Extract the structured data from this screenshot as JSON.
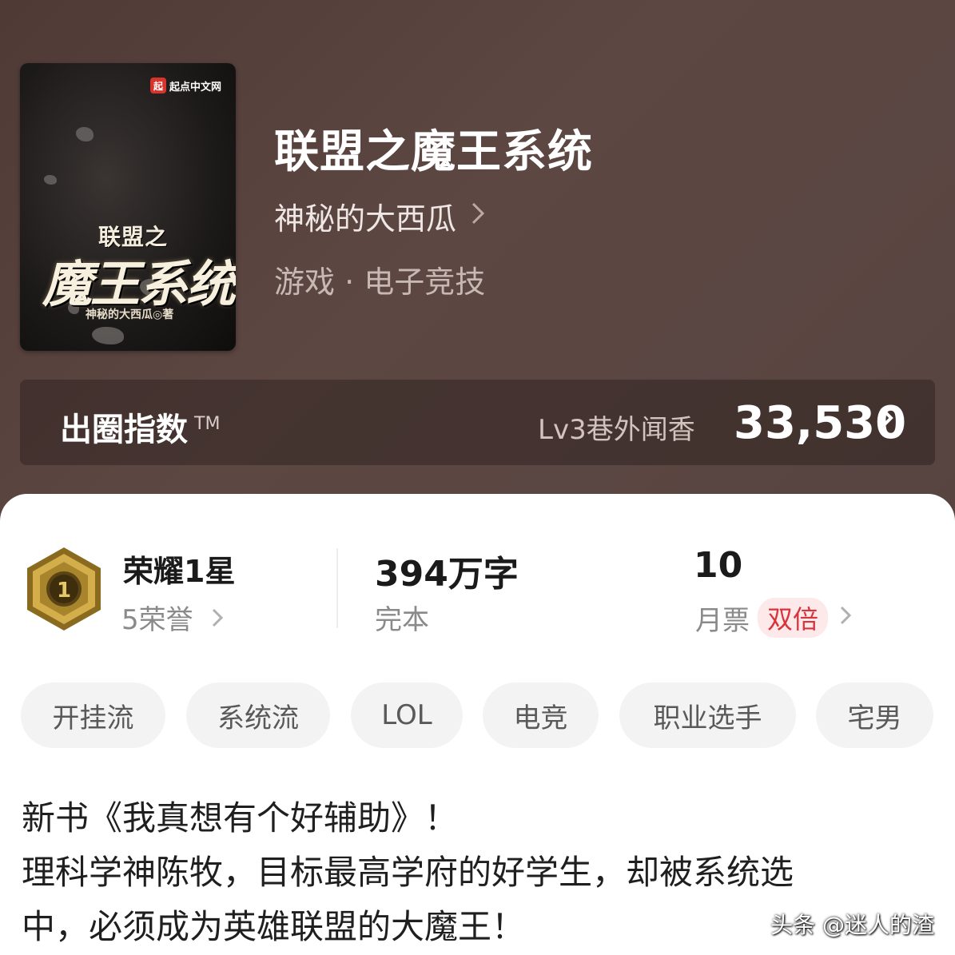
{
  "cover": {
    "publisher": "起点中文网",
    "publisher_logo": "起",
    "title_small": "联盟之",
    "title_big": "魔王系统",
    "author": "神秘的大西瓜◎著"
  },
  "book": {
    "title": "联盟之魔王系统",
    "author": "神秘的大西瓜",
    "genre": "游戏 · 电子竞技"
  },
  "popularity": {
    "label": "出圈指数",
    "tm": "TM",
    "level": "Lv3巷外闻香",
    "score": "33,530"
  },
  "stats": {
    "honor_title": "荣耀1星",
    "honor_sub": "5荣誉",
    "badge_number": "1",
    "words": "394",
    "words_unit": "万字",
    "status": "完本",
    "votes": "10",
    "votes_label": "月票",
    "double_label": "双倍"
  },
  "tags": [
    "开挂流",
    "系统流",
    "LOL",
    "电竞",
    "职业选手",
    "宅男"
  ],
  "description": {
    "line1": "新书《我真想有个好辅助》！",
    "line2": "理科学神陈牧，目标最高学府的好学生，却被系统选",
    "line3": "中，必须成为英雄联盟的大魔王！"
  },
  "watermark": "头条 @迷人的渣",
  "colors": {
    "header_bg": "#574440",
    "accent_red": "#d8343c",
    "tag_bg": "#f3f3f3"
  }
}
